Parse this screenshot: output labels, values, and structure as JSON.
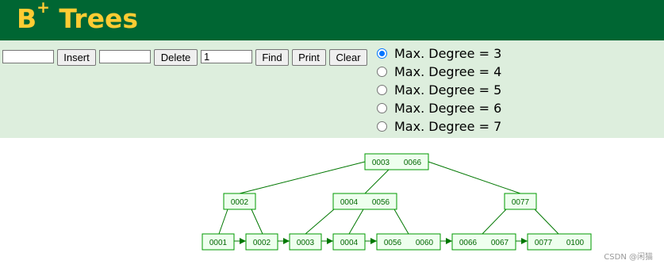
{
  "header": {
    "title": "B",
    "title_sup": "+",
    "title_rest": " Trees"
  },
  "controls": {
    "insert_value": "",
    "insert_label": "Insert",
    "delete_value": "",
    "delete_label": "Delete",
    "find_value": "1",
    "find_label": "Find",
    "print_label": "Print",
    "clear_label": "Clear",
    "degree_options": [
      {
        "label": "Max. Degree = 3",
        "checked": true
      },
      {
        "label": "Max. Degree = 4",
        "checked": false
      },
      {
        "label": "Max. Degree = 5",
        "checked": false
      },
      {
        "label": "Max. Degree = 6",
        "checked": false
      },
      {
        "label": "Max. Degree = 7",
        "checked": false
      }
    ]
  },
  "tree": {
    "root": {
      "keys": [
        "0003",
        "0066"
      ]
    },
    "internal": [
      {
        "keys": [
          "0002"
        ]
      },
      {
        "keys": [
          "0004",
          "0056"
        ]
      },
      {
        "keys": [
          "0077"
        ]
      }
    ],
    "leaves": [
      {
        "keys": [
          "0001"
        ]
      },
      {
        "keys": [
          "0002"
        ]
      },
      {
        "keys": [
          "0003"
        ]
      },
      {
        "keys": [
          "0004"
        ]
      },
      {
        "keys": [
          "0056",
          "0060"
        ]
      },
      {
        "keys": [
          "0066",
          "0067"
        ]
      },
      {
        "keys": [
          "0077",
          "0100"
        ]
      }
    ]
  },
  "colors": {
    "header_bg": "#006633",
    "title": "#ffcc33",
    "controls_bg": "#ddeedd",
    "node_fill": "#eeffee",
    "node_stroke": "#009900",
    "edge": "#007700"
  },
  "watermark": "CSDN @闲猫"
}
